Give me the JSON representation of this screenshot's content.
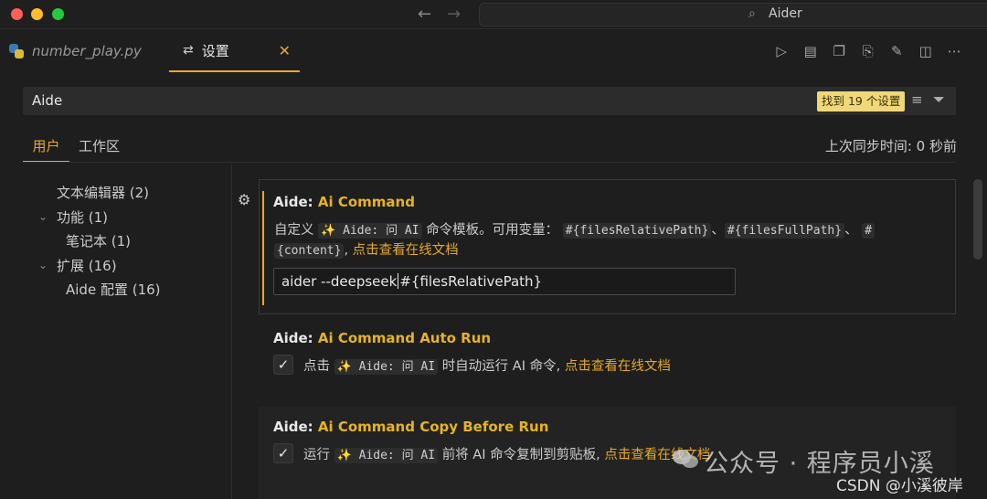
{
  "titlebar": {
    "search_label": "Aider"
  },
  "tabs": {
    "file_tab_label": "number_play.py",
    "settings_tab_label": "设置"
  },
  "search": {
    "value": "Aide",
    "results_badge": "找到 19 个设置"
  },
  "scopes": {
    "user_label": "用户",
    "workspace_label": "工作区",
    "sync_status": "上次同步时间: 0 秒前"
  },
  "toc": {
    "items": [
      {
        "label": "文本编辑器 (2)"
      },
      {
        "label": "功能 (1)"
      },
      {
        "label": "笔记本 (1)"
      },
      {
        "label": "扩展 (16)"
      },
      {
        "label": "Aide 配置 (16)"
      }
    ]
  },
  "settings": {
    "command": {
      "category": "Aide: ",
      "name": "Ai Command",
      "desc_1": "自定义",
      "code_1": "✨ Aide: 问 AI",
      "desc_2": "命令模板。可用变量：",
      "var_1": "#{filesRelativePath}",
      "sep_1": "、",
      "var_2": "#{filesFullPath}",
      "sep_2": "、",
      "var_3_part1": "#",
      "var_3_part2": "{content}",
      "sep_3": ", ",
      "link": "点击查看在线文档",
      "input_before_caret": "aider --deepseek",
      "input_after_caret": "#{filesRelativePath}"
    },
    "auto_run": {
      "category": "Aide: ",
      "name": "Ai Command Auto Run",
      "desc_1": "点击",
      "code_1": "✨ Aide: 问 AI",
      "desc_2": "时自动运行 AI 命令, ",
      "link": "点击查看在线文档",
      "checked": true
    },
    "copy_before_run": {
      "category": "Aide: ",
      "name": "Ai Command Copy Before Run",
      "desc_1": "运行",
      "code_1": "✨ Aide: 问 AI",
      "desc_2": "前将 AI 命令复制到剪贴板, ",
      "link": "点击查看在线文档",
      "checked": true
    }
  },
  "watermark": {
    "channel": "公众号 · 程序员小溪",
    "csdn": "CSDN @小溪彼岸"
  },
  "colors": {
    "accent": "#e6a928",
    "setting_name": "#e6b422",
    "badge_bg": "#f0d77a",
    "background": "#1e1e1e"
  }
}
